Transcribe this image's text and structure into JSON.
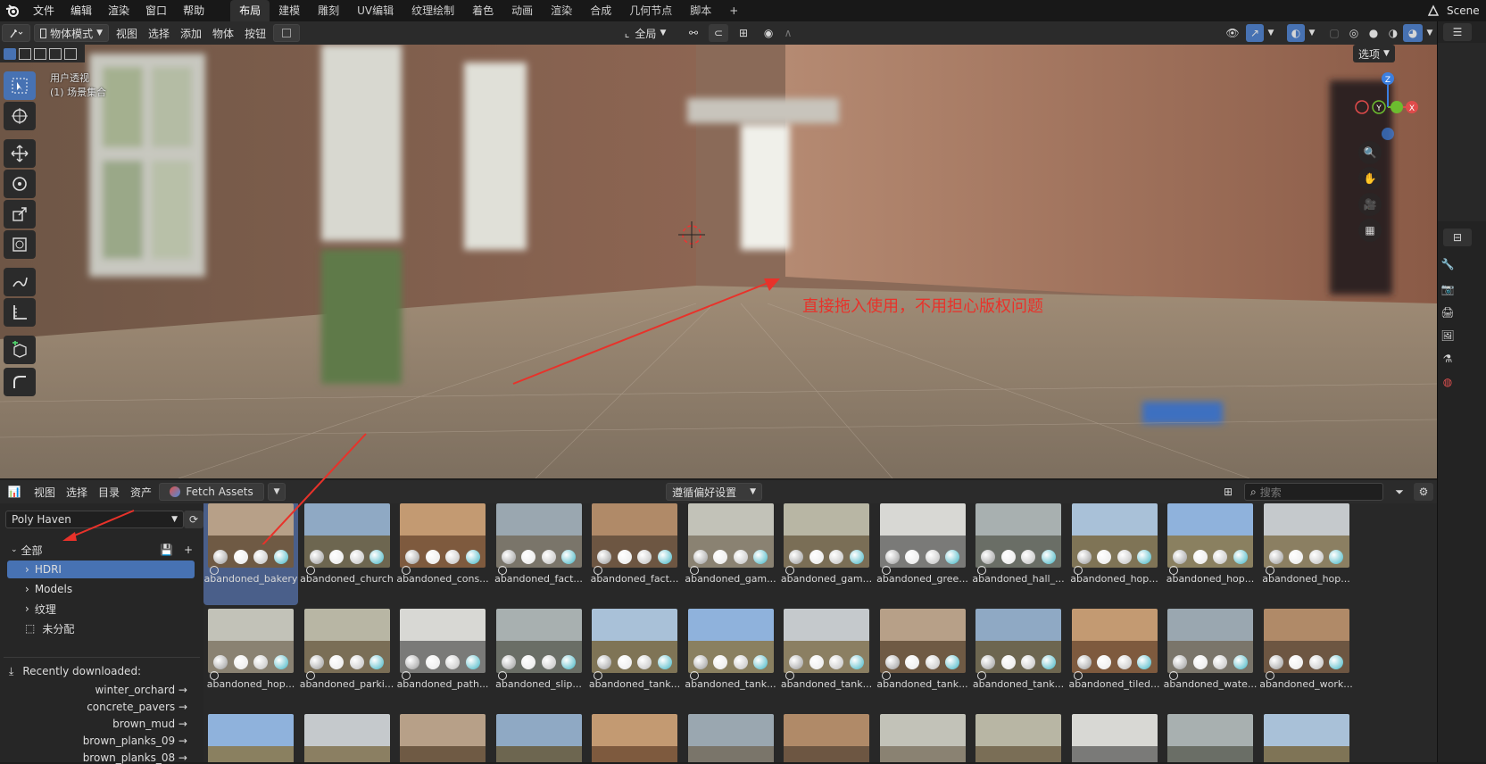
{
  "menu": {
    "file": "文件",
    "edit": "编辑",
    "render": "渲染",
    "window": "窗口",
    "help": "帮助"
  },
  "workspaces": [
    "布局",
    "建模",
    "雕刻",
    "UV编辑",
    "纹理绘制",
    "着色",
    "动画",
    "渲染",
    "合成",
    "几何节点",
    "脚本"
  ],
  "scene_name": "Scene",
  "viewport_header": {
    "mode": "物体模式",
    "view": "视图",
    "select": "选择",
    "add": "添加",
    "object": "物体",
    "button": "按钮",
    "transform": "全局",
    "options": "选项"
  },
  "viewport": {
    "view_name": "用户透视",
    "collection": "(1) 场景集合",
    "annotation": "直接拖入使用，不用担心版权问题"
  },
  "gizmo": {
    "z": "Z",
    "y": "Y",
    "x": "X"
  },
  "asset_header": {
    "view": "视图",
    "select": "选择",
    "catalog": "目录",
    "assets": "资产",
    "fetch": "Fetch Assets",
    "import_pref": "遵循偏好设置",
    "search_placeholder": "搜索"
  },
  "library": {
    "name": "Poly Haven",
    "all": "全部",
    "hdri": "HDRI",
    "models": "Models",
    "textures": "纹理",
    "unassigned": "未分配",
    "recent_title": "Recently downloaded:"
  },
  "recent": [
    "winter_orchard →",
    "concrete_pavers →",
    "brown_mud →",
    "brown_planks_09 →",
    "brown_planks_08 →"
  ],
  "assets_row1": [
    "abandoned_bakery",
    "abandoned_church",
    "abandoned_cons...",
    "abandoned_fact...",
    "abandoned_fact...",
    "abandoned_gam...",
    "abandoned_gam...",
    "abandoned_gree...",
    "abandoned_hall_...",
    "abandoned_hop...",
    "abandoned_hop...",
    "abandoned_hop..."
  ],
  "assets_row2": [
    "abandoned_hop...",
    "abandoned_parki...",
    "abandoned_path...",
    "abandoned_slip...",
    "abandoned_tank...",
    "abandoned_tank...",
    "abandoned_tank...",
    "abandoned_tank...",
    "abandoned_tank...",
    "abandoned_tiled...",
    "abandoned_wate...",
    "abandoned_work..."
  ],
  "colors": {
    "accent": "#4772b3",
    "annotation": "#e8322a",
    "selected": "#4a5f8a"
  }
}
